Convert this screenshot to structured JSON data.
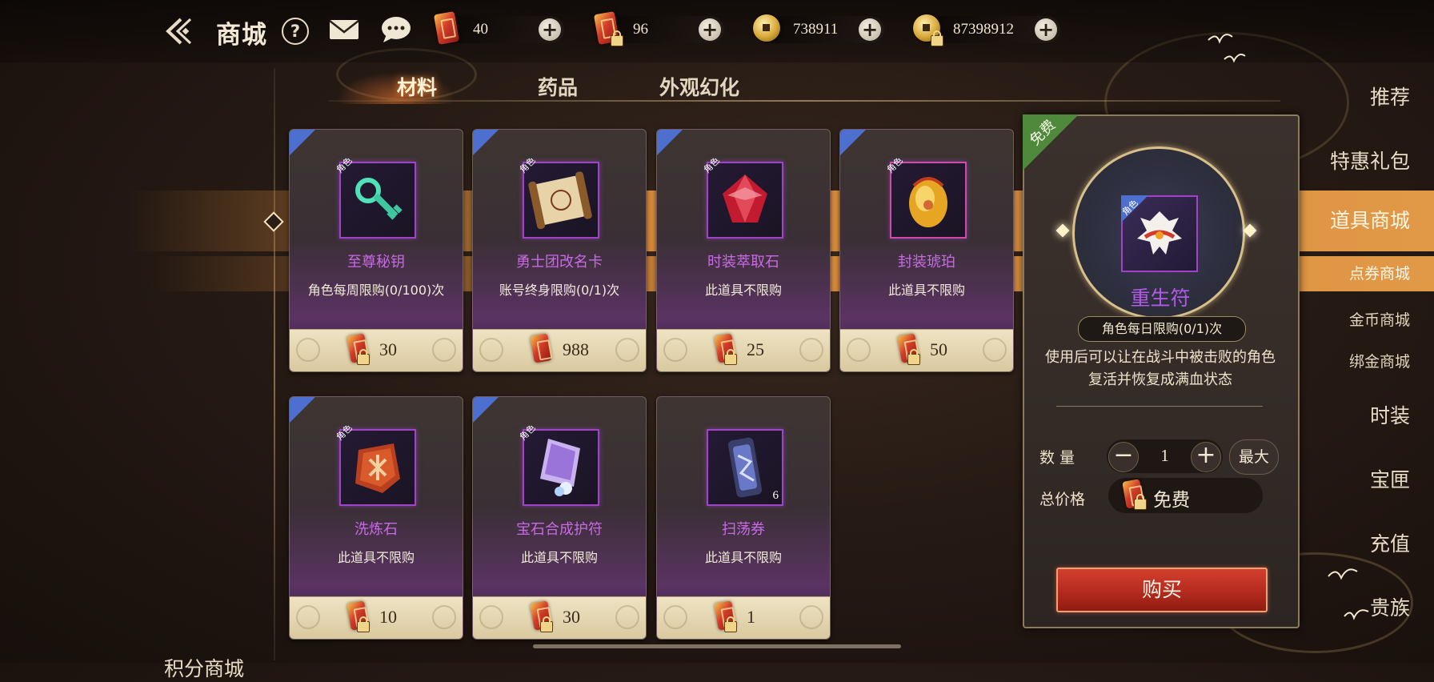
{
  "header": {
    "title": "商城",
    "help_glyph": "?",
    "currencies": [
      {
        "icon": "red-coupon-icon",
        "value": "40",
        "locked": false
      },
      {
        "icon": "bound-red-coupon-icon",
        "value": "96",
        "locked": true
      },
      {
        "icon": "gold-coin-icon",
        "value": "738911",
        "locked": false
      },
      {
        "icon": "bound-gold-coin-icon",
        "value": "87398912",
        "locked": true
      }
    ],
    "plus_glyph": "+"
  },
  "sidebar": {
    "items": [
      {
        "label": "推荐"
      },
      {
        "label": "特惠礼包"
      },
      {
        "label": "道具商城",
        "active": true
      },
      {
        "label": "时装"
      },
      {
        "label": "宝匣"
      },
      {
        "label": "充值"
      },
      {
        "label": "贵族"
      },
      {
        "label": "积分商城"
      }
    ],
    "sub_items": [
      {
        "label": "点券商城",
        "active": true
      },
      {
        "label": "金币商城"
      },
      {
        "label": "绑金商城"
      }
    ]
  },
  "tabs": [
    {
      "label": "材料",
      "active": true
    },
    {
      "label": "药品"
    },
    {
      "label": "外观幻化"
    }
  ],
  "items": [
    {
      "name": "至尊秘钥",
      "limit": "角色每周限购(0/100)次",
      "price": "30",
      "tag": "角色",
      "icon": "jade-key-icon"
    },
    {
      "name": "勇士团改名卡",
      "limit": "账号终身限购(0/1)次",
      "price": "988",
      "tag": "角色",
      "icon": "scroll-icon"
    },
    {
      "name": "时装萃取石",
      "limit": "此道具不限购",
      "price": "25",
      "tag": "角色",
      "icon": "red-crystal-icon"
    },
    {
      "name": "封装琥珀",
      "limit": "此道具不限购",
      "price": "50",
      "tag": "角色",
      "icon": "amber-icon"
    },
    {
      "name": "洗炼石",
      "limit": "此道具不限购",
      "price": "10",
      "tag": "角色",
      "icon": "rune-stone-icon"
    },
    {
      "name": "宝石合成护符",
      "limit": "此道具不限购",
      "price": "30",
      "tag": "角色",
      "icon": "talisman-icon"
    },
    {
      "name": "扫荡券",
      "limit": "此道具不限购",
      "price": "1",
      "tag": "",
      "qty": "6",
      "icon": "sweep-ticket-icon"
    }
  ],
  "detail": {
    "ribbon": "免费",
    "name": "重生符",
    "tag": "角色",
    "daily_limit": "角色每日限购(0/1)次",
    "description": "使用后可以让在战斗中被击败的角色复活并恢复成满血状态",
    "qty_label": "数量",
    "total_label": "总价格",
    "qty_value": "1",
    "minus_glyph": "−",
    "plus_glyph": "+",
    "max_label": "最大",
    "total_value": "免费",
    "buy_label": "购买"
  },
  "colors": {
    "accent": "#d78a3c",
    "item_name": "#c86ae6",
    "buy_button": "#b42a1d",
    "free_ribbon": "#4f8a3c"
  }
}
